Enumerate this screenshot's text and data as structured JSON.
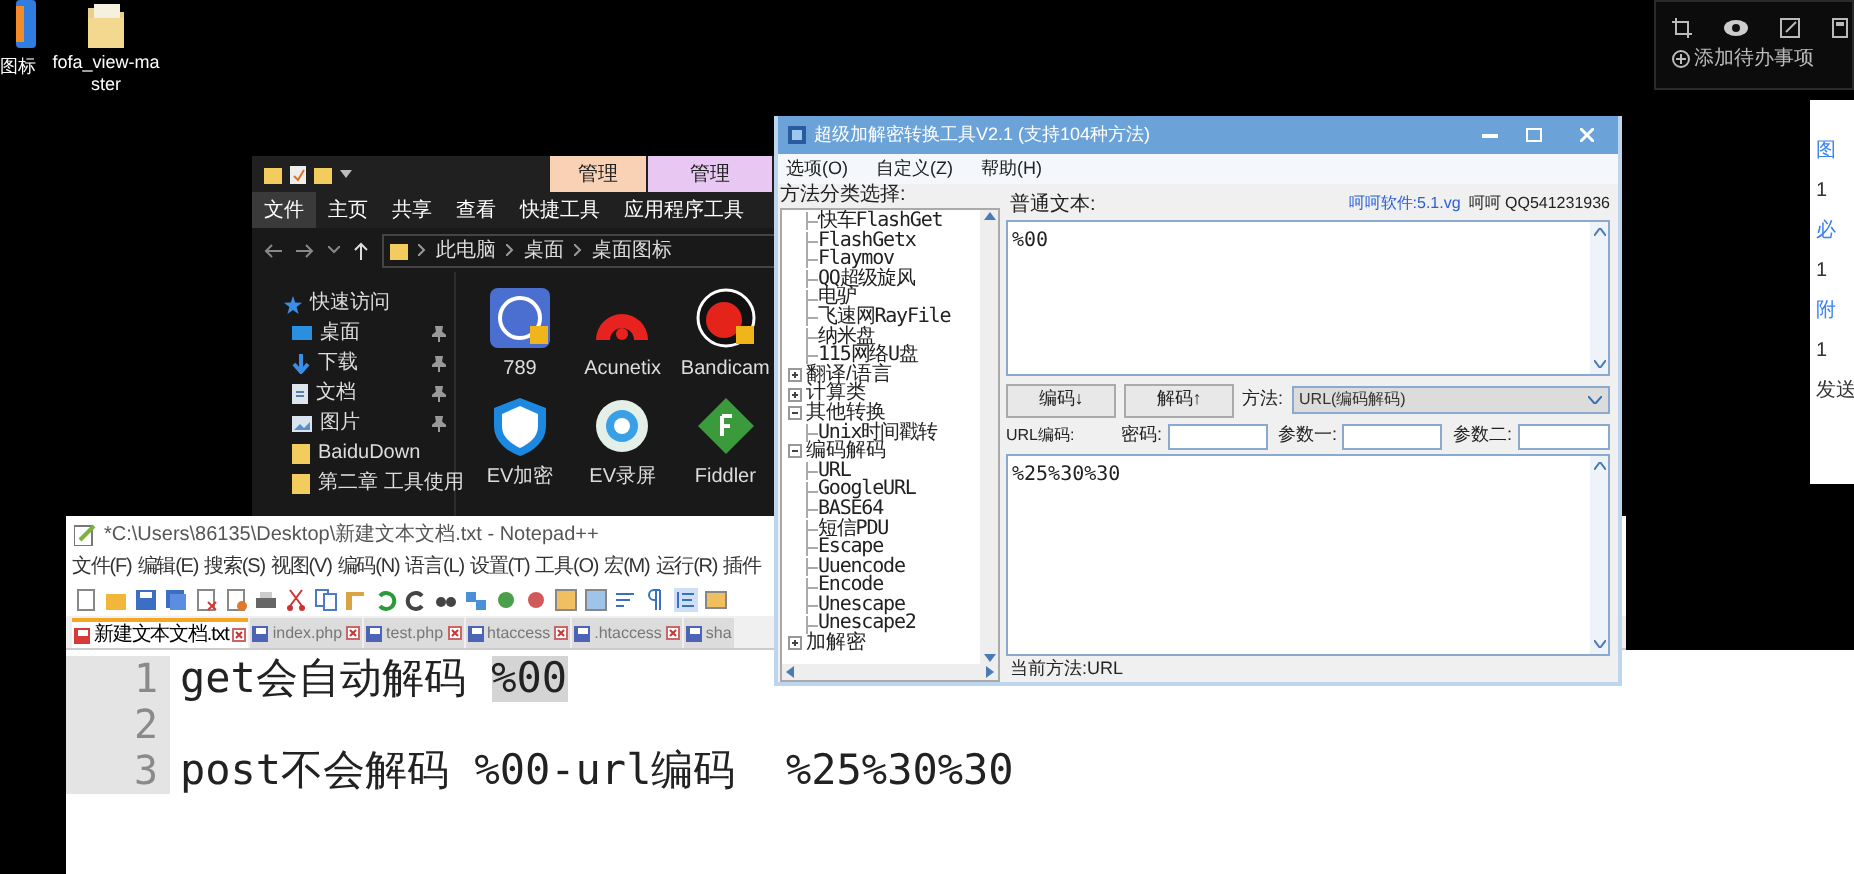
{
  "desktop_icons": [
    {
      "label": "图标",
      "kind": "app"
    },
    {
      "label": "fofa_view-master",
      "kind": "folder"
    }
  ],
  "todo_widget": {
    "add_label": "添加待办事项"
  },
  "side_panel": {
    "items": [
      {
        "text": "图",
        "kind": "link"
      },
      {
        "text": "1",
        "kind": "value"
      },
      {
        "text": "必",
        "kind": "link"
      },
      {
        "text": "1",
        "kind": "value"
      },
      {
        "text": "附",
        "kind": "link"
      },
      {
        "text": "1",
        "kind": "value"
      },
      {
        "text": "发送",
        "kind": "value"
      }
    ]
  },
  "explorer": {
    "context_tabs": [
      {
        "label": "管理",
        "color": "#f9d2b6"
      },
      {
        "label": "管理",
        "color": "#e8c8f2"
      }
    ],
    "ribbon_tabs": [
      {
        "label": "文件",
        "selected": true
      },
      {
        "label": "主页",
        "selected": false
      },
      {
        "label": "共享",
        "selected": false
      },
      {
        "label": "查看",
        "selected": false
      },
      {
        "label": "快捷工具",
        "selected": false
      },
      {
        "label": "应用程序工具",
        "selected": false
      }
    ],
    "breadcrumb": [
      "此电脑",
      "桌面",
      "桌面图标"
    ],
    "nav": [
      {
        "label": "快速访问",
        "kind": "star",
        "pinned": false
      },
      {
        "label": "桌面",
        "kind": "desktop",
        "pinned": true
      },
      {
        "label": "下载",
        "kind": "download",
        "pinned": true
      },
      {
        "label": "文档",
        "kind": "document",
        "pinned": true
      },
      {
        "label": "图片",
        "kind": "picture",
        "pinned": true
      },
      {
        "label": "BaiduDown",
        "kind": "folder",
        "pinned": false
      },
      {
        "label": "第二章 工具使用",
        "kind": "folder",
        "pinned": false
      }
    ],
    "files": [
      {
        "label": "789",
        "kind": "badge"
      },
      {
        "label": "Acunetix",
        "kind": "arc"
      },
      {
        "label": "Bandicam",
        "kind": "record"
      },
      {
        "label": "EV加密",
        "kind": "shield"
      },
      {
        "label": "EV录屏",
        "kind": "flower"
      },
      {
        "label": "Fiddler",
        "kind": "diamond"
      }
    ]
  },
  "tool": {
    "title": "超级加解密转换工具V2.1 (支持104种方法)",
    "menu": [
      "选项(O)",
      "自定义(Z)",
      "帮助(H)"
    ],
    "tree_label": "方法分类选择:",
    "tree": [
      {
        "children": [
          {
            "label": "快车FlashGet"
          },
          {
            "label": "FlashGetx"
          },
          {
            "label": "Flaymov"
          },
          {
            "label": "QQ超级旋风"
          },
          {
            "label": "电驴"
          },
          {
            "label": "飞速网RayFile"
          },
          {
            "label": "纳米盘"
          },
          {
            "label": "115网络U盘"
          }
        ]
      },
      {
        "label": "翻译/语言",
        "expanded": false
      },
      {
        "label": "计算类",
        "expanded": false
      },
      {
        "label": "其他转换",
        "expanded": true,
        "children": [
          {
            "label": "Unix时间戳转"
          }
        ]
      },
      {
        "label": "编码解码",
        "expanded": true,
        "children": [
          {
            "label": "URL"
          },
          {
            "label": "GoogleURL"
          },
          {
            "label": "BASE64"
          },
          {
            "label": "短信PDU"
          },
          {
            "label": "Escape"
          },
          {
            "label": "Uuencode"
          },
          {
            "label": "Encode"
          },
          {
            "label": "Unescape"
          },
          {
            "label": "Unescape2"
          }
        ]
      },
      {
        "label": "加解密",
        "expanded": false
      }
    ],
    "plain_label": "普通文本:",
    "site": "呵呵软件:5.1.vg",
    "qq": "呵呵 QQ541231936",
    "plain_text": "%00",
    "encode_button": "编码↓",
    "decode_button": "解码↑",
    "method_label": "方法:",
    "method": "URL(编码解码)",
    "result_label": "URL编码:",
    "password_label": "密码:",
    "param1_label": "参数一:",
    "param2_label": "参数二:",
    "result_text": "%25%30%30",
    "status": "当前方法:URL"
  },
  "notepad": {
    "title": "*C:\\Users\\86135\\Desktop\\新建文本文档.txt - Notepad++",
    "menu": [
      "文件(F)",
      "编辑(E)",
      "搜索(S)",
      "视图(V)",
      "编码(N)",
      "语言(L)",
      "设置(T)",
      "工具(O)",
      "宏(M)",
      "运行(R)",
      "插件"
    ],
    "tabs": [
      {
        "label": "新建文本文档.txt",
        "selected": true
      },
      {
        "label": "index.php",
        "selected": false
      },
      {
        "label": "test.php",
        "selected": false
      },
      {
        "label": "htaccess",
        "selected": false
      },
      {
        "label": ".htaccess",
        "selected": false
      },
      {
        "label": "sha",
        "selected": false
      }
    ],
    "lines": [
      {
        "number": "1",
        "segments": [
          {
            "text": "get会自动解码 ",
            "highlighted": false
          },
          {
            "text": "%00",
            "highlighted": true
          }
        ]
      },
      {
        "number": "2"
      },
      {
        "number": "3",
        "segments": [
          {
            "text": "post不会解码 %00-url编码  %25%30%30",
            "highlighted": false
          }
        ]
      }
    ]
  }
}
